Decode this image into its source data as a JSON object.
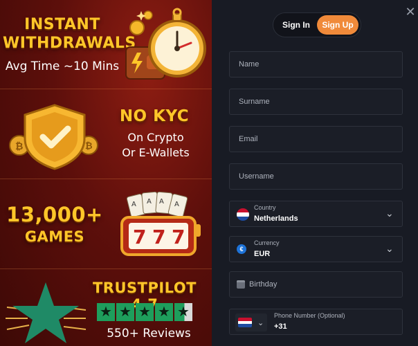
{
  "promo": {
    "block1": {
      "title_line1": "INSTANT",
      "title_line2": "WITHDRAWALS",
      "subtitle": "Avg Time ~10 Mins"
    },
    "block2": {
      "title": "NO KYC",
      "subtitle_line1": "On Crypto",
      "subtitle_line2": "Or E-Wallets"
    },
    "block3": {
      "title": "13,000+",
      "subtitle": "GAMES"
    },
    "block4": {
      "title": "TRUSTPILOT 4.7",
      "reviews": "550+ Reviews",
      "rating": 4.7
    }
  },
  "auth_toggle": {
    "sign_in": "Sign In",
    "sign_up": "Sign Up",
    "active": "Sign Up"
  },
  "form": {
    "name_placeholder": "Name",
    "surname_placeholder": "Surname",
    "email_placeholder": "Email",
    "username_placeholder": "Username",
    "country": {
      "label": "Country",
      "value": "Netherlands"
    },
    "currency": {
      "label": "Currency",
      "value": "EUR",
      "icon": "€"
    },
    "birthday_placeholder": "Birthday",
    "phone": {
      "label": "Phone Number (Optional)",
      "prefix": "+31"
    }
  },
  "colors": {
    "accent": "#f08a3a",
    "gold": "#ffc629",
    "trustpilot_green": "#1e9e5c",
    "panel_bg": "#181b24"
  },
  "icons": {
    "close": "close-icon",
    "chevron": "chevron-down-icon"
  }
}
